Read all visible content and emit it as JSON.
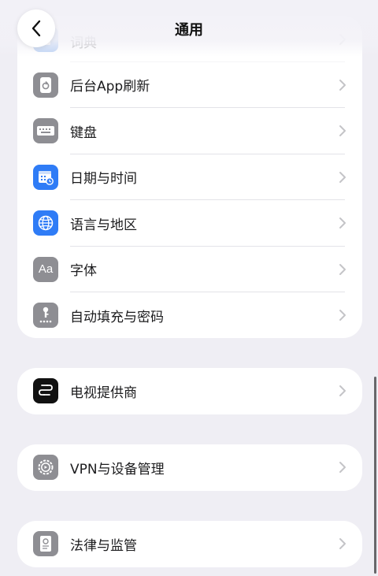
{
  "nav": {
    "title": "通用"
  },
  "group1": [
    {
      "label": "词典",
      "icon": "dictionary-icon",
      "color": "#3d7fe0"
    },
    {
      "label": "后台App刷新",
      "icon": "background-refresh-icon",
      "color": "#8e8e93"
    },
    {
      "label": "键盘",
      "icon": "keyboard-icon",
      "color": "#8e8e93"
    },
    {
      "label": "日期与时间",
      "icon": "calendar-clock-icon",
      "color": "#2f7cf6"
    },
    {
      "label": "语言与地区",
      "icon": "globe-icon",
      "color": "#2f7cf6"
    },
    {
      "label": "字体",
      "icon": "font-icon",
      "color": "#8e8e93",
      "icon_text": "Aa"
    },
    {
      "label": "自动填充与密码",
      "icon": "key-password-icon",
      "color": "#8e8e93"
    }
  ],
  "group2": [
    {
      "label": "电视提供商",
      "icon": "tv-provider-icon",
      "color": "#111111"
    }
  ],
  "group3": [
    {
      "label": "VPN与设备管理",
      "icon": "gear-icon",
      "color": "#8e8e93"
    }
  ],
  "group4": [
    {
      "label": "法律与监管",
      "icon": "legal-regulatory-icon",
      "color": "#8e8e93"
    }
  ]
}
